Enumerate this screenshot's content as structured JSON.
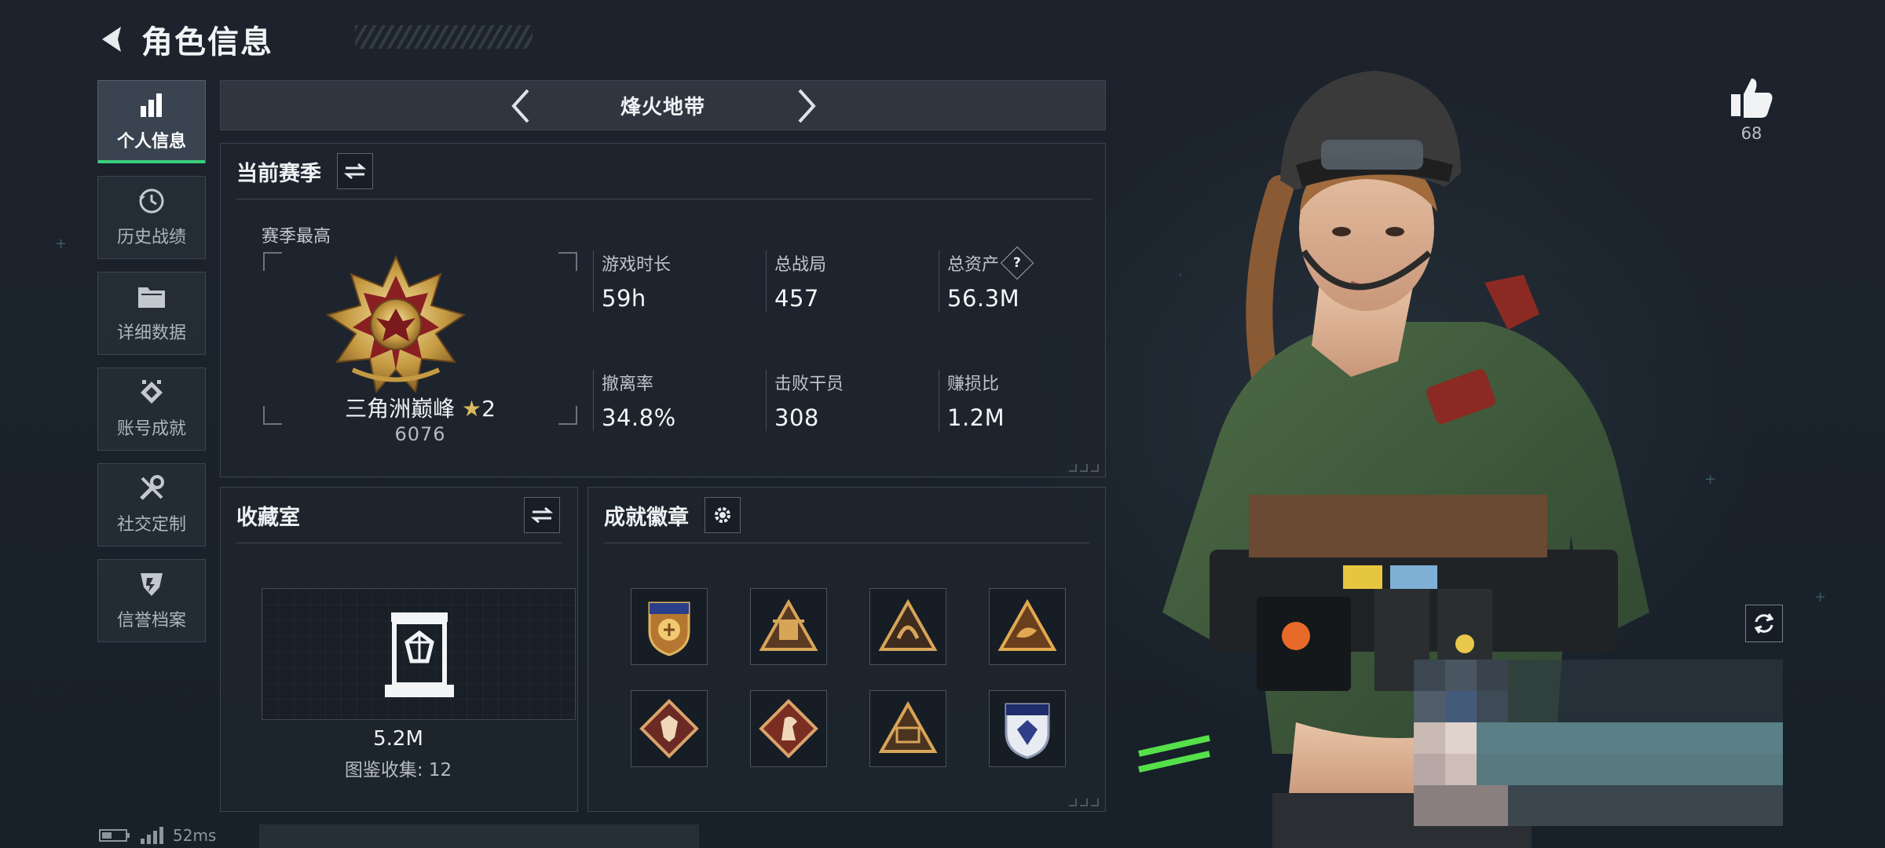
{
  "header": {
    "title": "角色信息"
  },
  "sidebar": {
    "items": [
      {
        "label": "个人信息",
        "icon": "bar-chart-icon",
        "active": true
      },
      {
        "label": "历史战绩",
        "icon": "history-clock-icon",
        "active": false
      },
      {
        "label": "详细数据",
        "icon": "folder-icon",
        "active": false
      },
      {
        "label": "账号成就",
        "icon": "achievement-icon",
        "active": false
      },
      {
        "label": "社交定制",
        "icon": "tools-icon",
        "active": false
      },
      {
        "label": "信誉档案",
        "icon": "shield-icon",
        "active": false
      }
    ]
  },
  "mode": {
    "title": "烽火地带"
  },
  "season": {
    "title": "当前赛季",
    "subtitle": "赛季最高",
    "rank_name": "三角洲巅峰",
    "rank_level": "2",
    "rank_score": "6076",
    "stats": [
      {
        "label": "游戏时长",
        "value": "59h"
      },
      {
        "label": "总战局",
        "value": "457"
      },
      {
        "label": "总资产",
        "value": "56.3M",
        "help": "?"
      },
      {
        "label": "撤离率",
        "value": "34.8%"
      },
      {
        "label": "击败干员",
        "value": "308"
      },
      {
        "label": "赚损比",
        "value": "1.2M"
      }
    ]
  },
  "collection": {
    "title": "收藏室",
    "value": "5.2M",
    "count_text": "图鉴收集: 12"
  },
  "achievements": {
    "title": "成就徽章",
    "badge_count": 8
  },
  "likes": {
    "count": "68"
  },
  "status": {
    "ping": "52ms"
  },
  "colors": {
    "accent_green": "#39d17e",
    "gold": "#d6b860",
    "background": "#1b222b"
  }
}
